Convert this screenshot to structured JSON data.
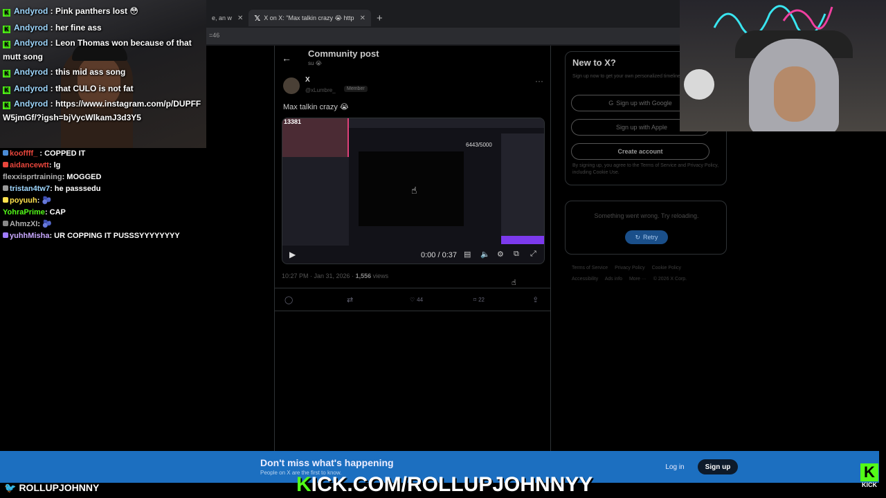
{
  "browser": {
    "tabs": [
      {
        "label": "e, an w",
        "active": false
      },
      {
        "label": "X on X: \"Max talkin crazy 😭 http",
        "active": true
      }
    ],
    "new_tab_icon": "+",
    "url_fragment": "=46"
  },
  "x_page": {
    "header": {
      "title": "Community post",
      "subtitle": "su 😭"
    },
    "post": {
      "author": "X",
      "handle": "@xLumbre_",
      "badge": "Member",
      "text": "Max talkin crazy 😭",
      "meta_time": "10:27 PM · Jan 31, 2026 · ",
      "meta_views": "1,556",
      "meta_views_label": " views",
      "actions": {
        "likes": "44",
        "bookmarks": "22"
      }
    },
    "video": {
      "counter": "13381",
      "goal": "6443/5000",
      "time": "0:00 / 0:37"
    },
    "sidebar": {
      "new_title": "New to X?",
      "new_sub": "Sign up now to get your own personalized timeline!",
      "google": "Sign up with Google",
      "apple": "Sign up with Apple",
      "create": "Create account",
      "terms": "By signing up, you agree to the Terms of Service and Privacy Policy, including Cookie Use.",
      "error": "Something went wrong. Try reloading.",
      "retry": "Retry",
      "footer": [
        "Terms of Service",
        "Privacy Policy",
        "Cookie Policy",
        "Accessibility",
        "Ads info",
        "More ···",
        "© 2026 X Corp."
      ]
    },
    "banner": {
      "title": "Don't miss what's happening",
      "sub": "People on X are the first to know.",
      "login": "Log in",
      "signup": "Sign up"
    }
  },
  "chat_top": [
    {
      "user": "Andyrod",
      "text": " : Pink panthers lost 😳"
    },
    {
      "user": "Andyrod",
      "text": " : her fine ass"
    },
    {
      "user": "Andyrod",
      "text": " : Leon Thomas won because of that mutt song"
    },
    {
      "user": "Andyrod",
      "text": " : this mid ass song"
    },
    {
      "user": "Andyrod",
      "text": " : that CULO is not fat"
    },
    {
      "user": "Andyrod",
      "text": " :  https://www.instagram.com/p/DUPFFW5jmGf/?igsh=bjVycWlkamJ3d3Y5"
    }
  ],
  "chat_bottom": [
    {
      "user": "kooffff_",
      "text": " : COPPED IT",
      "color": "#e8463c"
    },
    {
      "user": "aidancewtt",
      "text": ": lg",
      "color": "#e8463c"
    },
    {
      "user": "flexxisprtraining",
      "text": ": MOGGED",
      "color": "#b0b0b0"
    },
    {
      "user": "tristan4tw7",
      "text": ": he passsedu",
      "color": "#9fd8ff"
    },
    {
      "user": "poyuuh",
      "text": ": 🫐",
      "color": "#ffe14d"
    },
    {
      "user": "YohraPrime",
      "text": ": CAP",
      "color": "#53fc18"
    },
    {
      "user": "AhmzXI",
      "text": ": 🫐",
      "color": "#b0b0b0"
    },
    {
      "user": "yuhhMisha",
      "text": ": UR COPPING IT PUSSSYYYYYYYY",
      "color": "#c9a8ff"
    }
  ],
  "overlay": {
    "twitter": "ROLLUPJOHNNY",
    "kick_k": "K",
    "kick_rest": "ICK.COM/ROLLUPJOHNNYY",
    "kick_logo": "K",
    "kick_logo_text": "KICK"
  },
  "colors": {
    "kick_green": "#53fc18",
    "x_blue": "#1d9bf0",
    "banner_blue": "#1c6fc0"
  }
}
